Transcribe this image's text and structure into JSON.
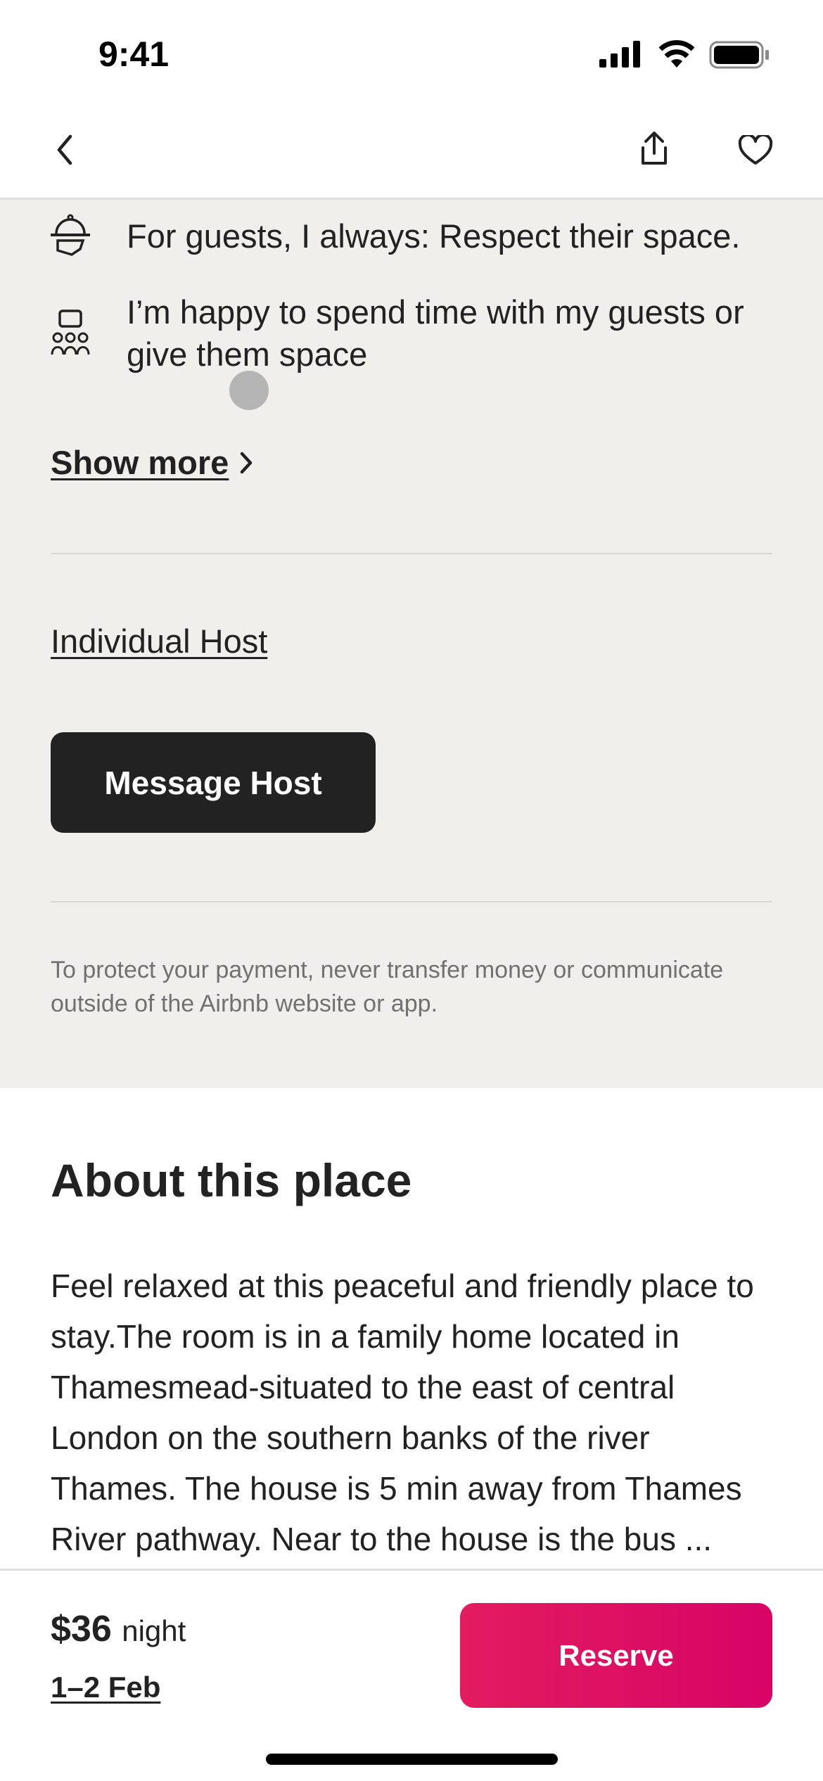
{
  "status_bar": {
    "time": "9:41"
  },
  "nav": {
    "back_icon": "chevron-left-icon",
    "share_icon": "share-icon",
    "favorite_icon": "heart-icon"
  },
  "host_details": {
    "items": [
      {
        "icon": "serving-bell-icon",
        "text": "For guests, I always: Respect their space."
      },
      {
        "icon": "people-chat-icon",
        "text": "I’m happy to spend time with my guests or give them space"
      }
    ],
    "show_more": "Show more",
    "individual_host": "Individual Host",
    "message_host": "Message Host",
    "disclaimer": "To protect your payment, never transfer money or communicate outside of the Airbnb website or app."
  },
  "about": {
    "heading": "About this place",
    "text": "Feel relaxed at this peaceful and friendly place to stay.The room is in a family home located in Thamesmead-situated to the east of central London on the southern banks of the river Thames. The house is 5 min away from Thames River pathway. Near to the house is the bus ..."
  },
  "footer": {
    "price": "$36",
    "unit": "night",
    "dates": "1–2 Feb",
    "reserve": "Reserve",
    "accent": "#e31c5f"
  }
}
